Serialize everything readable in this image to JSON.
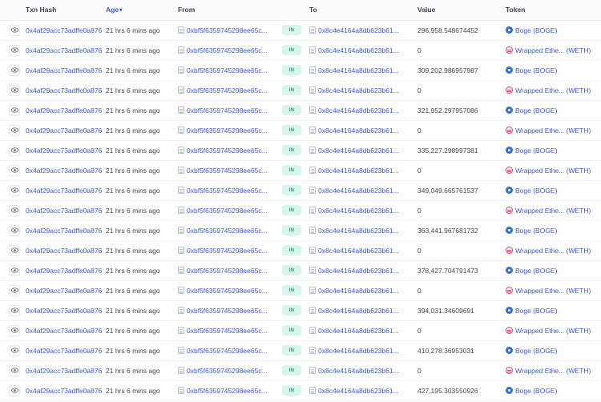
{
  "table": {
    "columns": [
      {
        "key": "eye",
        "label": "",
        "sortable": false
      },
      {
        "key": "hash",
        "label": "Txn Hash",
        "sortable": false
      },
      {
        "key": "age",
        "label": "Age",
        "sortable": true
      },
      {
        "key": "from",
        "label": "From",
        "sortable": false
      },
      {
        "key": "dir",
        "label": "",
        "sortable": false
      },
      {
        "key": "to",
        "label": "To",
        "sortable": false
      },
      {
        "key": "value",
        "label": "Value",
        "sortable": false
      },
      {
        "key": "token",
        "label": "Token",
        "sortable": false
      }
    ],
    "sort_caret": "▾",
    "icons": {
      "eye": "eye-icon",
      "document": "document-icon",
      "boge": "boge-token-icon",
      "weth": "weth-token-icon"
    },
    "direction_badge": "IN",
    "rows": [
      {
        "hash": "0x4af29acc73adffe0a876...",
        "age": "21 hrs 6 mins ago",
        "from": "0xbf5f6359745298ee65c...",
        "dir": "IN",
        "to": "0x8c4e4164a8db623b61...",
        "value": "296,958.548674452",
        "token_name": "Boge (BOGE)",
        "token_kind": "boge"
      },
      {
        "hash": "0x4af29acc73adffe0a876...",
        "age": "21 hrs 6 mins ago",
        "from": "0xbf5f6359745298ee65c...",
        "dir": "IN",
        "to": "0x8c4e4164a8db623b61...",
        "value": "0",
        "token_name": "Wrapped Ethe... (WETH)",
        "token_kind": "weth"
      },
      {
        "hash": "0x4af29acc73adffe0a876...",
        "age": "21 hrs 6 mins ago",
        "from": "0xbf5f6359745298ee65c...",
        "dir": "IN",
        "to": "0x8c4e4164a8db623b61...",
        "value": "309,202.986957987",
        "token_name": "Boge (BOGE)",
        "token_kind": "boge"
      },
      {
        "hash": "0x4af29acc73adffe0a876...",
        "age": "21 hrs 6 mins ago",
        "from": "0xbf5f6359745298ee65c...",
        "dir": "IN",
        "to": "0x8c4e4164a8db623b61...",
        "value": "0",
        "token_name": "Wrapped Ethe... (WETH)",
        "token_kind": "weth"
      },
      {
        "hash": "0x4af29acc73adffe0a876...",
        "age": "21 hrs 6 mins ago",
        "from": "0xbf5f6359745298ee65c...",
        "dir": "IN",
        "to": "0x8c4e4164a8db623b61...",
        "value": "321,952.297957086",
        "token_name": "Boge (BOGE)",
        "token_kind": "boge"
      },
      {
        "hash": "0x4af29acc73adffe0a876...",
        "age": "21 hrs 6 mins ago",
        "from": "0xbf5f6359745298ee65c...",
        "dir": "IN",
        "to": "0x8c4e4164a8db623b61...",
        "value": "0",
        "token_name": "Wrapped Ethe... (WETH)",
        "token_kind": "weth"
      },
      {
        "hash": "0x4af29acc73adffe0a876...",
        "age": "21 hrs 6 mins ago",
        "from": "0xbf5f6359745298ee65c...",
        "dir": "IN",
        "to": "0x8c4e4164a8db623b61...",
        "value": "335,227.298997381",
        "token_name": "Boge (BOGE)",
        "token_kind": "boge"
      },
      {
        "hash": "0x4af29acc73adffe0a876...",
        "age": "21 hrs 6 mins ago",
        "from": "0xbf5f6359745298ee65c...",
        "dir": "IN",
        "to": "0x8c4e4164a8db623b61...",
        "value": "0",
        "token_name": "Wrapped Ethe... (WETH)",
        "token_kind": "weth"
      },
      {
        "hash": "0x4af29acc73adffe0a876...",
        "age": "21 hrs 6 mins ago",
        "from": "0xbf5f6359745298ee65c...",
        "dir": "IN",
        "to": "0x8c4e4164a8db623b61...",
        "value": "349,049.665761537",
        "token_name": "Boge (BOGE)",
        "token_kind": "boge"
      },
      {
        "hash": "0x4af29acc73adffe0a876...",
        "age": "21 hrs 6 mins ago",
        "from": "0xbf5f6359745298ee65c...",
        "dir": "IN",
        "to": "0x8c4e4164a8db623b61...",
        "value": "0",
        "token_name": "Wrapped Ethe... (WETH)",
        "token_kind": "weth"
      },
      {
        "hash": "0x4af29acc73adffe0a876...",
        "age": "21 hrs 6 mins ago",
        "from": "0xbf5f6359745298ee65c...",
        "dir": "IN",
        "to": "0x8c4e4164a8db623b61...",
        "value": "363,441.967681732",
        "token_name": "Boge (BOGE)",
        "token_kind": "boge"
      },
      {
        "hash": "0x4af29acc73adffe0a876...",
        "age": "21 hrs 6 mins ago",
        "from": "0xbf5f6359745298ee65c...",
        "dir": "IN",
        "to": "0x8c4e4164a8db623b61...",
        "value": "0",
        "token_name": "Wrapped Ethe... (WETH)",
        "token_kind": "weth"
      },
      {
        "hash": "0x4af29acc73adffe0a876...",
        "age": "21 hrs 6 mins ago",
        "from": "0xbf5f6359745298ee65c...",
        "dir": "IN",
        "to": "0x8c4e4164a8db623b61...",
        "value": "378,427.704791473",
        "token_name": "Boge (BOGE)",
        "token_kind": "boge"
      },
      {
        "hash": "0x4af29acc73adffe0a876...",
        "age": "21 hrs 6 mins ago",
        "from": "0xbf5f6359745298ee65c...",
        "dir": "IN",
        "to": "0x8c4e4164a8db623b61...",
        "value": "0",
        "token_name": "Wrapped Ethe... (WETH)",
        "token_kind": "weth"
      },
      {
        "hash": "0x4af29acc73adffe0a876...",
        "age": "21 hrs 6 mins ago",
        "from": "0xbf5f6359745298ee65c...",
        "dir": "IN",
        "to": "0x8c4e4164a8db623b61...",
        "value": "394,031.34609691",
        "token_name": "Boge (BOGE)",
        "token_kind": "boge"
      },
      {
        "hash": "0x4af29acc73adffe0a876...",
        "age": "21 hrs 6 mins ago",
        "from": "0xbf5f6359745298ee65c...",
        "dir": "IN",
        "to": "0x8c4e4164a8db623b61...",
        "value": "0",
        "token_name": "Wrapped Ethe... (WETH)",
        "token_kind": "weth"
      },
      {
        "hash": "0x4af29acc73adffe0a876...",
        "age": "21 hrs 6 mins ago",
        "from": "0xbf5f6359745298ee65c...",
        "dir": "IN",
        "to": "0x8c4e4164a8db623b61...",
        "value": "410,278.36953031",
        "token_name": "Boge (BOGE)",
        "token_kind": "boge"
      },
      {
        "hash": "0x4af29acc73adffe0a876...",
        "age": "21 hrs 6 mins ago",
        "from": "0xbf5f6359745298ee65c...",
        "dir": "IN",
        "to": "0x8c4e4164a8db623b61...",
        "value": "0",
        "token_name": "Wrapped Ethe... (WETH)",
        "token_kind": "weth"
      },
      {
        "hash": "0x4af29acc73adffe0a876...",
        "age": "21 hrs 6 mins ago",
        "from": "0xbf5f6359745298ee65c...",
        "dir": "IN",
        "to": "0x8c4e4164a8db623b61...",
        "value": "427,195.303550926",
        "token_name": "Boge (BOGE)",
        "token_kind": "boge"
      }
    ]
  },
  "colors": {
    "link": "#3a54e8",
    "text": "#3b3f4a",
    "header_bg": "#fbfcfd",
    "row_border": "#eef0f3",
    "badge_bg": "#d7f5e9",
    "badge_text": "#2a9d72",
    "boge": "#2f6fe0",
    "weth": "#d9455f"
  }
}
